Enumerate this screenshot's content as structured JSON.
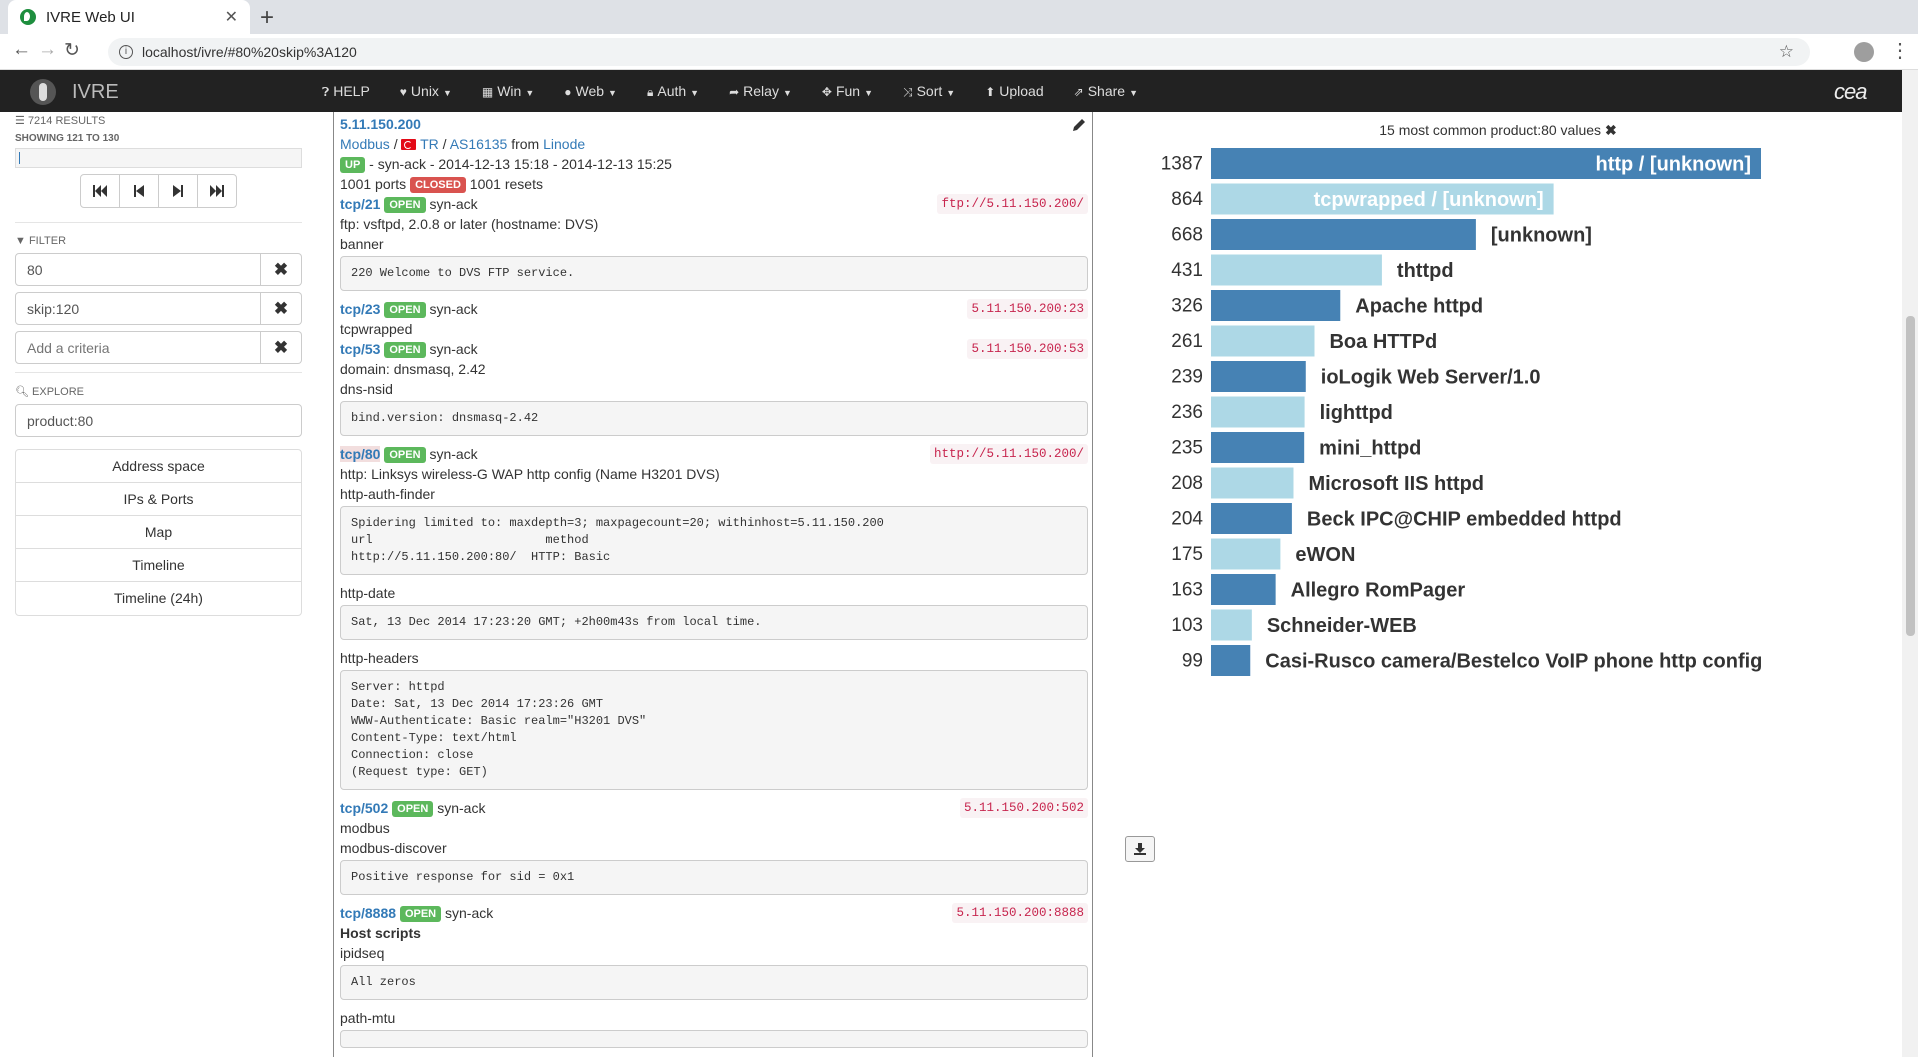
{
  "browser": {
    "tab_title": "IVRE Web UI",
    "url": "localhost/ivre/#80%20skip%3A120"
  },
  "app": {
    "brand": "IVRE",
    "logo_text": "cea",
    "menu": [
      {
        "icon": "question-circle-icon",
        "label": "HELP",
        "caret": false
      },
      {
        "icon": "heart-icon",
        "label": "Unix",
        "caret": true
      },
      {
        "icon": "windows-icon",
        "label": "Win",
        "caret": true
      },
      {
        "icon": "globe-icon",
        "label": "Web",
        "caret": true
      },
      {
        "icon": "lock-icon",
        "label": "Auth",
        "caret": true
      },
      {
        "icon": "share-arrow-icon",
        "label": "Relay",
        "caret": true
      },
      {
        "icon": "crosshair-icon",
        "label": "Fun",
        "caret": true
      },
      {
        "icon": "shuffle-icon",
        "label": "Sort",
        "caret": true
      },
      {
        "icon": "upload-icon",
        "label": "Upload",
        "caret": false
      },
      {
        "icon": "share-icon",
        "label": "Share",
        "caret": true
      }
    ]
  },
  "sidebar": {
    "results_count": "7214 RESULTS",
    "showing": "SHOWING 121 TO 130",
    "progress": 0.0,
    "filter_title": "FILTER",
    "filters": [
      "80",
      "skip:120"
    ],
    "add_placeholder": "Add a criteria",
    "explore_title": "EXPLORE",
    "explore_value": "product:80",
    "views": [
      "Address space",
      "IPs & Ports",
      "Map",
      "Timeline",
      "Timeline (24h)"
    ]
  },
  "host": {
    "ip": "5.11.150.200",
    "category": "Modbus",
    "country": "TR",
    "as": "AS16135",
    "from_word": "from",
    "source": "Linode",
    "state": "UP",
    "state_line": " - syn-ack - 2014-12-13 15:18 - 2014-12-13 15:25",
    "ports_count": "1001 ports",
    "closed_label": "CLOSED",
    "resets": "1001 resets",
    "ports": [
      {
        "id": "tcp/21",
        "state": "OPEN",
        "reason": "syn-ack",
        "url": "ftp://5.11.150.200/",
        "lines": [
          "ftp: vsftpd, 2.0.8 or later (hostname: DVS)"
        ],
        "scripts": [
          {
            "name": "banner",
            "output": "220 Welcome to DVS FTP service."
          }
        ]
      },
      {
        "id": "tcp/23",
        "state": "OPEN",
        "reason": "syn-ack",
        "url": "5.11.150.200:23",
        "lines": [
          "tcpwrapped"
        ],
        "scripts": []
      },
      {
        "id": "tcp/53",
        "state": "OPEN",
        "reason": "syn-ack",
        "url": "5.11.150.200:53",
        "lines": [
          "domain: dnsmasq, 2.42"
        ],
        "scripts": [
          {
            "name": "dns-nsid",
            "output": "bind.version: dnsmasq-2.42"
          }
        ]
      },
      {
        "id": "tcp/80",
        "state": "OPEN",
        "reason": "syn-ack",
        "url": "http://5.11.150.200/",
        "highlight": true,
        "lines": [
          "http: Linksys wireless-G WAP http config (Name H3201 DVS)"
        ],
        "scripts": [
          {
            "name": "http-auth-finder",
            "output": "Spidering limited to: maxdepth=3; maxpagecount=20; withinhost=5.11.150.200\nurl                        method\nhttp://5.11.150.200:80/  HTTP: Basic"
          },
          {
            "name": "http-date",
            "output": "Sat, 13 Dec 2014 17:23:20 GMT; +2h00m43s from local time."
          },
          {
            "name": "http-headers",
            "output": "Server: httpd\nDate: Sat, 13 Dec 2014 17:23:26 GMT\nWWW-Authenticate: Basic realm=\"H3201 DVS\"\nContent-Type: text/html\nConnection: close\n(Request type: GET)"
          }
        ]
      },
      {
        "id": "tcp/502",
        "state": "OPEN",
        "reason": "syn-ack",
        "url": "5.11.150.200:502",
        "lines": [
          "modbus"
        ],
        "scripts": [
          {
            "name": "modbus-discover",
            "output": "Positive response for sid = 0x1"
          }
        ]
      },
      {
        "id": "tcp/8888",
        "state": "OPEN",
        "reason": "syn-ack",
        "url": "5.11.150.200:8888",
        "lines": [],
        "scripts": []
      }
    ],
    "host_scripts_title": "Host scripts",
    "host_scripts": [
      {
        "name": "ipidseq",
        "output": "All zeros"
      },
      {
        "name": "path-mtu",
        "output": ""
      }
    ]
  },
  "chart_data": {
    "type": "bar",
    "orientation": "horizontal",
    "title": "15 most common product:80 values",
    "categories": [
      "http / [unknown]",
      "tcpwrapped / [unknown]",
      "[unknown]",
      "thttpd",
      "Apache httpd",
      "Boa HTTPd",
      "ioLogik Web Server/1.0",
      "lighttpd",
      "mini_httpd",
      "Microsoft IIS httpd",
      "Beck IPC@CHIP embedded httpd",
      "eWON",
      "Allegro RomPager",
      "Schneider-WEB",
      "Casi-Rusco camera/Bestelco VoIP phone http config"
    ],
    "values": [
      1387,
      864,
      668,
      431,
      326,
      261,
      239,
      236,
      235,
      208,
      204,
      175,
      163,
      103,
      99
    ],
    "colors": [
      "#4682b4",
      "#add8e6"
    ]
  }
}
